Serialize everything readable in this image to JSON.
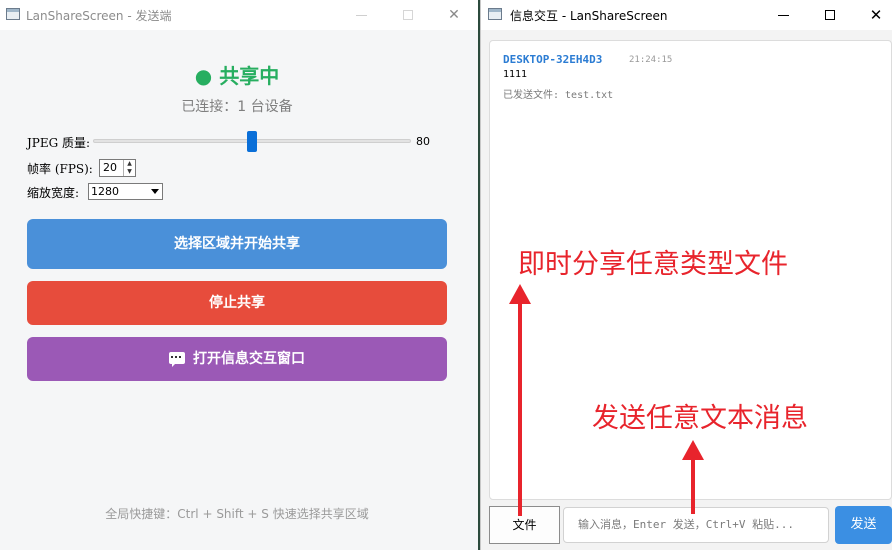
{
  "left_window": {
    "title": "LanShareScreen - 发送端",
    "status": "● 共享中",
    "connected": "已连接：1 台设备",
    "jpeg_label": "JPEG 质量:",
    "jpeg_value": "80",
    "jpeg_level": 0.5,
    "fps_label": "帧率 (FPS):",
    "fps_value": "20",
    "scale_label": "缩放宽度:",
    "scale_value": "1280",
    "btn_select": "选择区域并开始共享",
    "btn_stop": "停止共享",
    "btn_chat": "打开信息交互窗口",
    "hint": "全局快捷键：Ctrl + Shift + S 快速选择共享区域",
    "colors": {
      "status": "#27ae60",
      "blue": "#4a90d9",
      "red": "#e74c3c",
      "purple": "#9b59b6"
    }
  },
  "right_window": {
    "title": "信息交互 - LanShareScreen",
    "message": {
      "sender": "DESKTOP-32EH4D3",
      "time": "21:24:15",
      "text": "1111",
      "file_note": "已发送文件: test.txt"
    },
    "file_button": "文件",
    "input_placeholder": "输入消息，Enter 发送，Ctrl+V 粘贴...",
    "send_button": "发送",
    "colors": {
      "sender": "#2b7cd3",
      "send": "#3b8fe3"
    }
  },
  "annotations": {
    "file_share": "即时分享任意类型文件",
    "text_message": "发送任意文本消息",
    "color": "#e8242c"
  }
}
